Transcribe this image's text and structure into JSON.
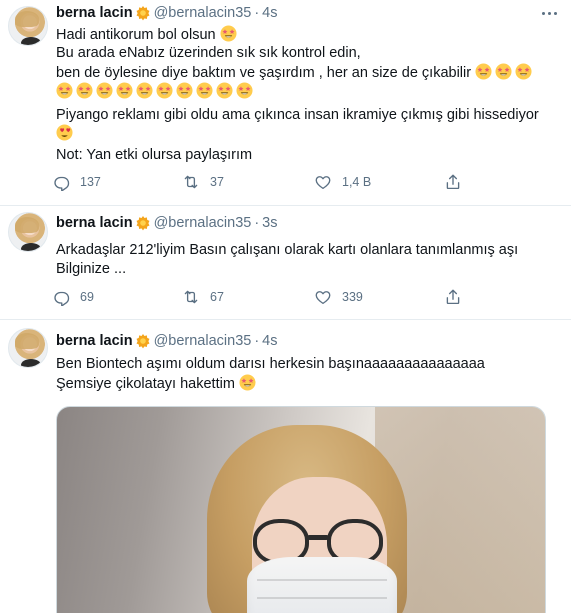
{
  "timeline": {
    "tweets": [
      {
        "name": "berna lacin",
        "handle": "@bernalacin35",
        "separator": "·",
        "time": "4s",
        "lines": [
          "Hadi antikorum bol olsun",
          "Bu arada eNabız üzerinden sık sık kontrol edin,",
          "ben de öylesine diye baktım ve şaşırdım , her an size de çıkabilir",
          "",
          "Piyango reklamı gibi oldu ama çıkınca insan ikramiye çıkmış gibi hissediyor",
          "",
          "Not: Yan etki olursa paylaşırım"
        ],
        "stats": {
          "replies": "137",
          "retweets": "37",
          "likes": "1,4 B"
        }
      },
      {
        "name": "berna lacin",
        "handle": "@bernalacin35",
        "separator": "·",
        "time": "3s",
        "lines": [
          "Arkadaşlar 212'liyim Basın çalışanı olarak kartı olanlara tanımlanmış aşı",
          "Bilginize ..."
        ],
        "stats": {
          "replies": "69",
          "retweets": "67",
          "likes": "339"
        }
      },
      {
        "name": "berna lacin",
        "handle": "@bernalacin35",
        "separator": "·",
        "time": "4s",
        "lines": [
          "Ben Biontech aşımı oldum darısı herkesin başınaaaaaaaaaaaaaaa",
          "Şemsiye çikolatayı hakettim"
        ],
        "media_description": "selfie photo"
      }
    ]
  },
  "icons": {
    "verified": "sun-badge-icon",
    "emoji": "star-struck-emoji-icon",
    "heart_eyes": "heart-eyes-emoji-icon",
    "reply": "reply-icon",
    "retweet": "retweet-icon",
    "like": "heart-icon",
    "share": "share-icon",
    "more": "more-icon"
  },
  "colors": {
    "text": "#0f1419",
    "secondary": "#5b7083",
    "border": "#e6ecf0",
    "badge": "#f4a51c"
  }
}
